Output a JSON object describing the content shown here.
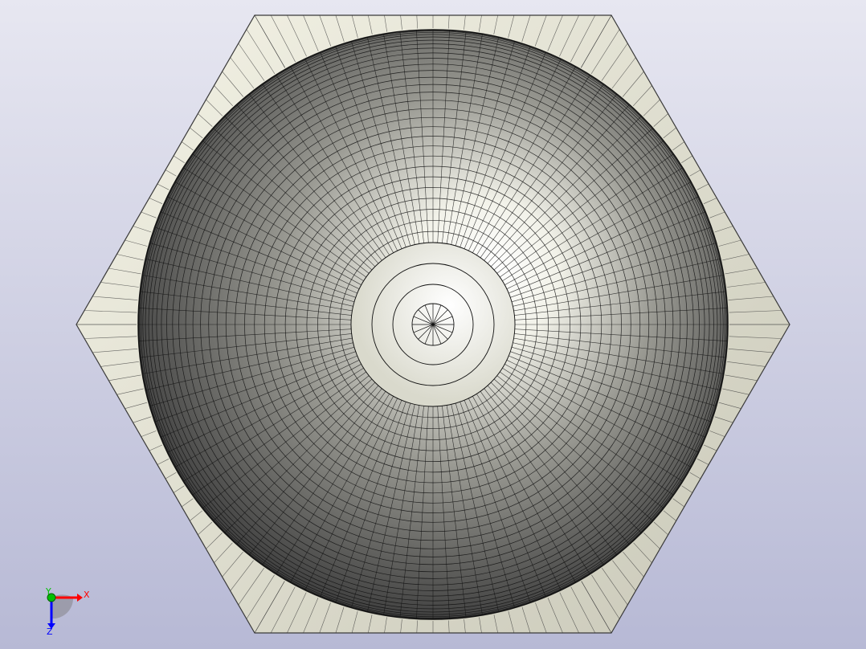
{
  "viewport": {
    "background_top": "#e7e7f1",
    "background_bottom": "#b7b9d5"
  },
  "model": {
    "nut_face_color": "#e0dfd0",
    "nut_edge_color": "#3a3a3a",
    "dome_light_color": "#ffffff",
    "dome_mid_color": "#9a9a93",
    "dome_dark_color": "#3e3e3e",
    "mesh_line_color": "#111111"
  },
  "triad": {
    "x_label": "X",
    "y_label": "Y",
    "z_label": "Z",
    "x_color": "#ff0000",
    "y_color": "#00c000",
    "z_color": "#0000ff"
  }
}
